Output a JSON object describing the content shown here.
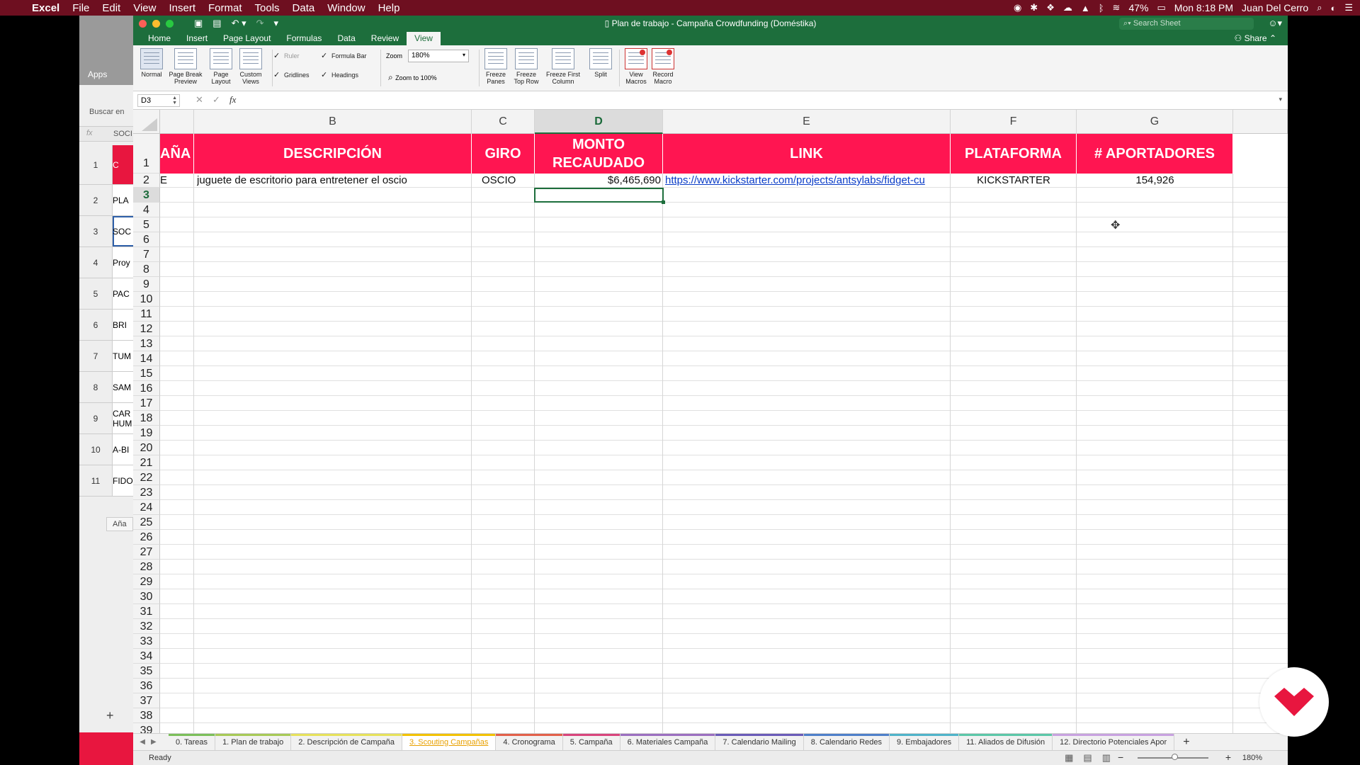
{
  "menubar": {
    "app": "Excel",
    "items": [
      "File",
      "Edit",
      "View",
      "Insert",
      "Format",
      "Tools",
      "Data",
      "Window",
      "Help"
    ],
    "battery": "47%",
    "clock": "Mon 8:18 PM",
    "user": "Juan Del Cerro"
  },
  "bg_window": {
    "apps_label": "Apps",
    "search_placeholder": "Buscar en",
    "fx_text": "SOCI",
    "rows": [
      {
        "n": "1",
        "v": "C"
      },
      {
        "n": "2",
        "v": "PLA"
      },
      {
        "n": "3",
        "v": "SOC"
      },
      {
        "n": "4",
        "v": "Proy"
      },
      {
        "n": "5",
        "v": "PAC"
      },
      {
        "n": "6",
        "v": "BRI"
      },
      {
        "n": "7",
        "v": "TUM"
      },
      {
        "n": "8",
        "v": "SAM"
      },
      {
        "n": "9",
        "v": "CAR HUM"
      },
      {
        "n": "10",
        "v": "A-BI"
      },
      {
        "n": "11",
        "v": "FIDO"
      }
    ],
    "add_label": "Aña",
    "plus": "+"
  },
  "window": {
    "title": "Plan de trabajo - Campaña Crowdfunding (Doméstika)",
    "search_placeholder": "Search Sheet"
  },
  "ribbon_tabs": {
    "items": [
      "Home",
      "Insert",
      "Page Layout",
      "Formulas",
      "Data",
      "Review",
      "View"
    ],
    "active": "View",
    "share": "Share"
  },
  "ribbon": {
    "views": [
      "Normal",
      "Page Break Preview",
      "Page Layout",
      "Custom Views"
    ],
    "ruler": "Ruler",
    "formula_bar": "Formula Bar",
    "gridlines": "Gridlines",
    "headings": "Headings",
    "zoom_label": "Zoom",
    "zoom_value": "180%",
    "zoom_100": "Zoom to 100%",
    "freeze": [
      "Freeze Panes",
      "Freeze Top Row",
      "Freeze First Column"
    ],
    "split": "Split",
    "macros": [
      "View Macros",
      "Record Macro"
    ]
  },
  "formula_bar": {
    "name_box": "D3",
    "cancel": "✕",
    "enter": "✓",
    "fx": "fx",
    "value": ""
  },
  "grid": {
    "columns": [
      "B",
      "C",
      "D",
      "E",
      "F",
      "G"
    ],
    "active_column": "D",
    "row_numbers": [
      "1",
      "2",
      "3",
      "4",
      "5",
      "6",
      "7",
      "8",
      "9",
      "10",
      "11",
      "12",
      "13",
      "14",
      "15",
      "16",
      "17",
      "18",
      "19",
      "20",
      "21",
      "22",
      "23",
      "24",
      "25",
      "26",
      "27",
      "28",
      "29",
      "30",
      "31",
      "32",
      "33",
      "34",
      "35",
      "36",
      "37",
      "38",
      "39"
    ],
    "active_row": "3",
    "header_row": {
      "partial_a": "AÑA",
      "b": "DESCRIPCIÓN",
      "c": "GIRO",
      "d": "MONTO RECAUDADO",
      "e": "LINK",
      "f": "PLATAFORMA",
      "g": "# APORTADORES"
    },
    "row2": {
      "partial_a": "E",
      "b": "juguete de escritorio para entretener el oscio",
      "c": "OSCIO",
      "d": "$6,465,690",
      "e": "https://www.kickstarter.com/projects/antsylabs/fidget-cu",
      "f": "KICKSTARTER",
      "g": "154,926"
    },
    "selected_cell": "D3"
  },
  "sheet_tabs": [
    {
      "label": "0. Tareas",
      "color": "#7bbf5a"
    },
    {
      "label": "1. Plan de trabajo",
      "color": "#a7c957"
    },
    {
      "label": "2. Descripción de Campaña",
      "color": "#e6e25a"
    },
    {
      "label": "3. Scouting Campañas",
      "color": "#f2c200",
      "active": true
    },
    {
      "label": "4. Cronograma",
      "color": "#e2604a"
    },
    {
      "label": "5. Campaña",
      "color": "#d8447c"
    },
    {
      "label": "6. Materiales Campaña",
      "color": "#9b6fc0"
    },
    {
      "label": "7. Calendario Mailing",
      "color": "#6a5bb8"
    },
    {
      "label": "8. Calendario Redes",
      "color": "#4e7fc9"
    },
    {
      "label": "9. Embajadores",
      "color": "#4fb3c9"
    },
    {
      "label": "11. Aliados de Difusión",
      "color": "#5bc7a8"
    },
    {
      "label": "12. Directorio Potenciales Apor",
      "color": "#c8a2e0"
    }
  ],
  "status": {
    "ready": "Ready",
    "zoom": "180%"
  },
  "colors": {
    "header_fill": "#ff1551",
    "excel_green": "#1d6e3c",
    "menubar": "#6e0f20",
    "link": "#0a3cc7"
  }
}
